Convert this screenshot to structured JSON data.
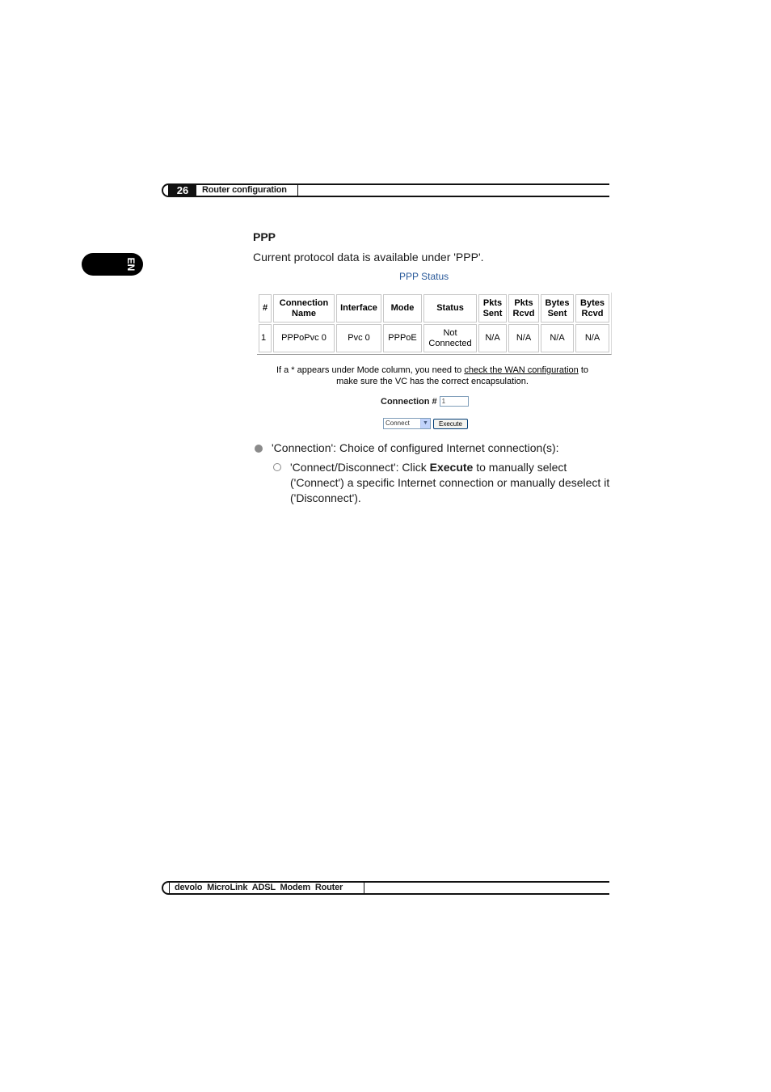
{
  "header": {
    "page_number": "26",
    "section": "Router configuration"
  },
  "language_tab": "EN",
  "section": {
    "title": "PPP",
    "intro": "Current protocol data is available under 'PPP'."
  },
  "ppp_status": {
    "title": "PPP Status",
    "columns": [
      "#",
      "Connection Name",
      "Interface",
      "Mode",
      "Status",
      "Pkts Sent",
      "Pkts Rcvd",
      "Bytes Sent",
      "Bytes Rcvd"
    ],
    "column_lines": [
      [
        "#"
      ],
      [
        "Connection",
        "Name"
      ],
      [
        "Interface"
      ],
      [
        "Mode"
      ],
      [
        "Status"
      ],
      [
        "Pkts",
        "Sent"
      ],
      [
        "Pkts",
        "Rcvd"
      ],
      [
        "Bytes",
        "Sent"
      ],
      [
        "Bytes",
        "Rcvd"
      ]
    ],
    "rows": [
      {
        "num": "1",
        "connection_name": "PPPoPvc 0",
        "interface": "Pvc 0",
        "mode": "PPPoE",
        "status_line1": "Not",
        "status_line2": "Connected",
        "pkts_sent": "N/A",
        "pkts_rcvd": "N/A",
        "bytes_sent": "N/A",
        "bytes_rcvd": "N/A"
      }
    ],
    "note_before_link": "If a * appears under Mode column, you need to ",
    "note_link": "check the WAN configuration",
    "note_after_link": " to",
    "note_line2": "make sure the VC has the correct encapsulation.",
    "connection_label": "Connection #",
    "connection_value": "1",
    "action_select_value": "Connect",
    "execute_label": "Execute"
  },
  "bullets": {
    "item1": "'Connection': Choice of configured Internet connection(s):",
    "item2_before": "'Connect/Disconnect': Click ",
    "item2_bold": "Execute",
    "item2_after": " to manually select ('Connect') a specific Internet connection or manually deselect it ('Disconnect')."
  },
  "footer": {
    "brand": "devolo MicroLink ADSL Modem Router"
  }
}
